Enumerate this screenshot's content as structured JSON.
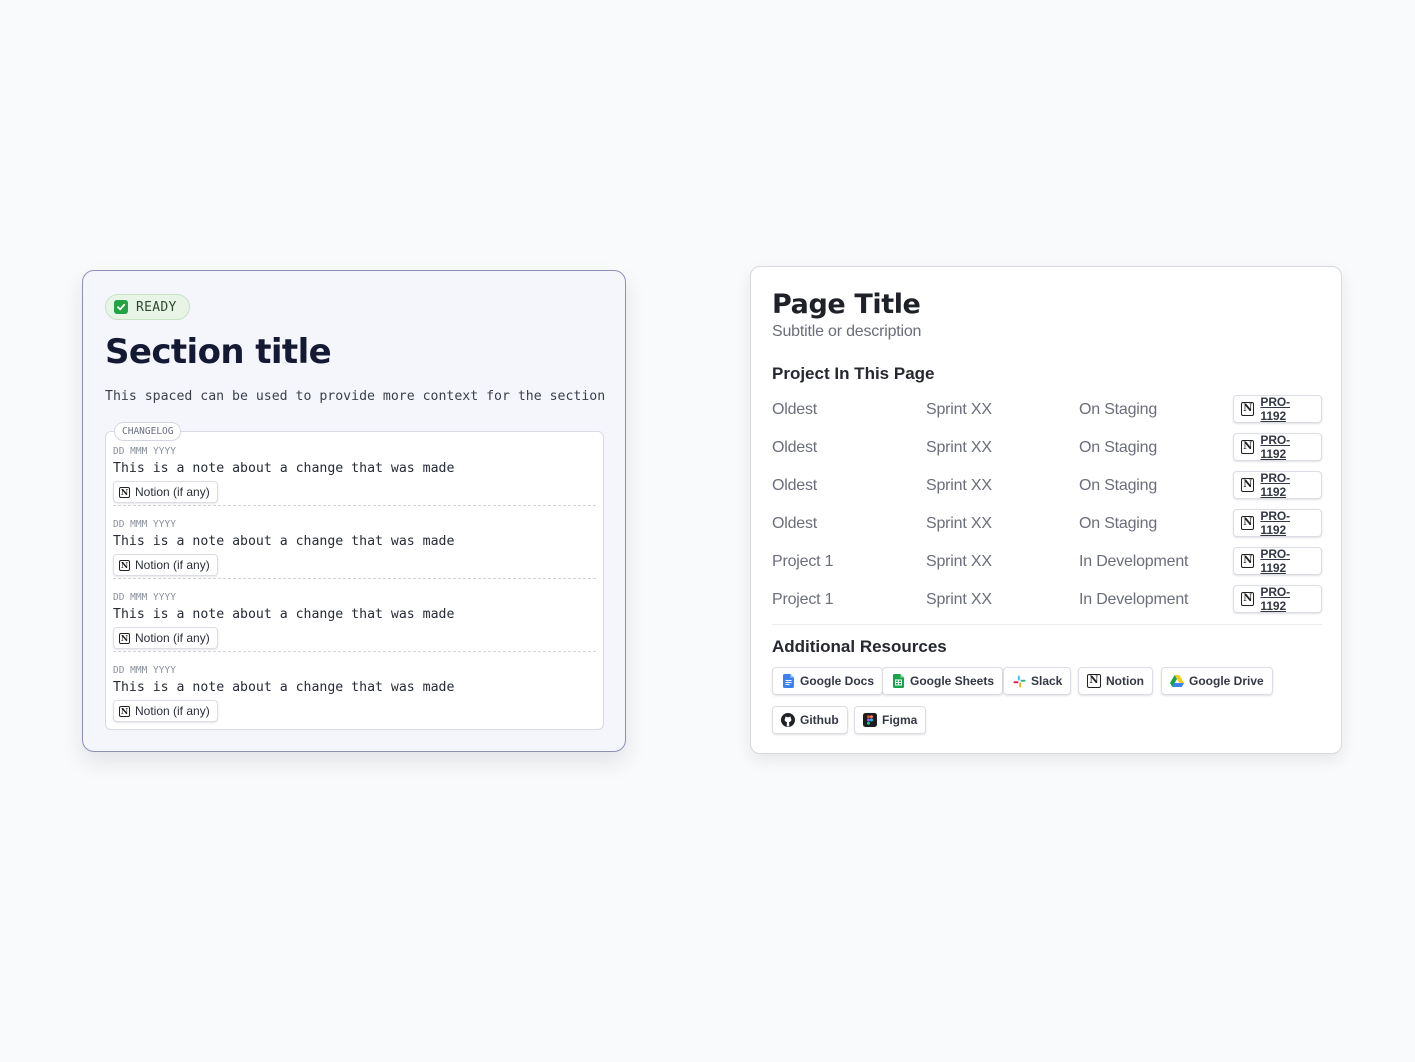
{
  "status_card": {
    "badge": {
      "label": "READY",
      "icon": "check-box-icon",
      "color": "#22a344"
    },
    "title": "Section title",
    "description": "This spaced can be used to provide more context for the section",
    "changelog": {
      "tag": "CHANGELOG",
      "entries": [
        {
          "date": "DD MMM YYYY",
          "note": "This is a note about a change that was made",
          "link_label": "Notion (if any)",
          "link_icon": "notion-icon"
        },
        {
          "date": "DD MMM YYYY",
          "note": "This is a note about a change that was made",
          "link_label": "Notion (if any)",
          "link_icon": "notion-icon"
        },
        {
          "date": "DD MMM YYYY",
          "note": "This is a note about a change that was made",
          "link_label": "Notion (if any)",
          "link_icon": "notion-icon"
        },
        {
          "date": "DD MMM YYYY",
          "note": "This is a note about a change that was made",
          "link_label": "Notion (if any)",
          "link_icon": "notion-icon"
        }
      ]
    }
  },
  "page_card": {
    "title": "Page Title",
    "subtitle": "Subtitle or description",
    "projects": {
      "heading": "Project In This Page",
      "rows": [
        {
          "name": "Oldest",
          "sprint": "Sprint XX",
          "status": "On Staging",
          "ticket": "PRO-1192"
        },
        {
          "name": "Oldest",
          "sprint": "Sprint XX",
          "status": "On Staging",
          "ticket": "PRO-1192"
        },
        {
          "name": "Oldest",
          "sprint": "Sprint XX",
          "status": "On Staging",
          "ticket": "PRO-1192"
        },
        {
          "name": "Oldest",
          "sprint": "Sprint XX",
          "status": "On Staging",
          "ticket": "PRO-1192"
        },
        {
          "name": "Project 1",
          "sprint": "Sprint XX",
          "status": "In Development",
          "ticket": "PRO-1192"
        },
        {
          "name": "Project 1",
          "sprint": "Sprint XX",
          "status": "In Development",
          "ticket": "PRO-1192"
        }
      ]
    },
    "resources": {
      "heading": "Additional Resources",
      "items": [
        {
          "label": "Google Docs",
          "icon": "google-docs-icon"
        },
        {
          "label": "Google Sheets",
          "icon": "google-sheets-icon"
        },
        {
          "label": "Slack",
          "icon": "slack-icon"
        },
        {
          "label": "Notion",
          "icon": "notion-icon"
        },
        {
          "label": "Google Drive",
          "icon": "google-drive-icon"
        },
        {
          "label": "Github",
          "icon": "github-icon"
        },
        {
          "label": "Figma",
          "icon": "figma-icon"
        }
      ]
    }
  },
  "colors": {
    "page_background": "#f9fafb",
    "status_card_border": "#8f90b8",
    "status_card_background": "#f5f6fb",
    "ready_badge_background": "#e7f4e6"
  }
}
